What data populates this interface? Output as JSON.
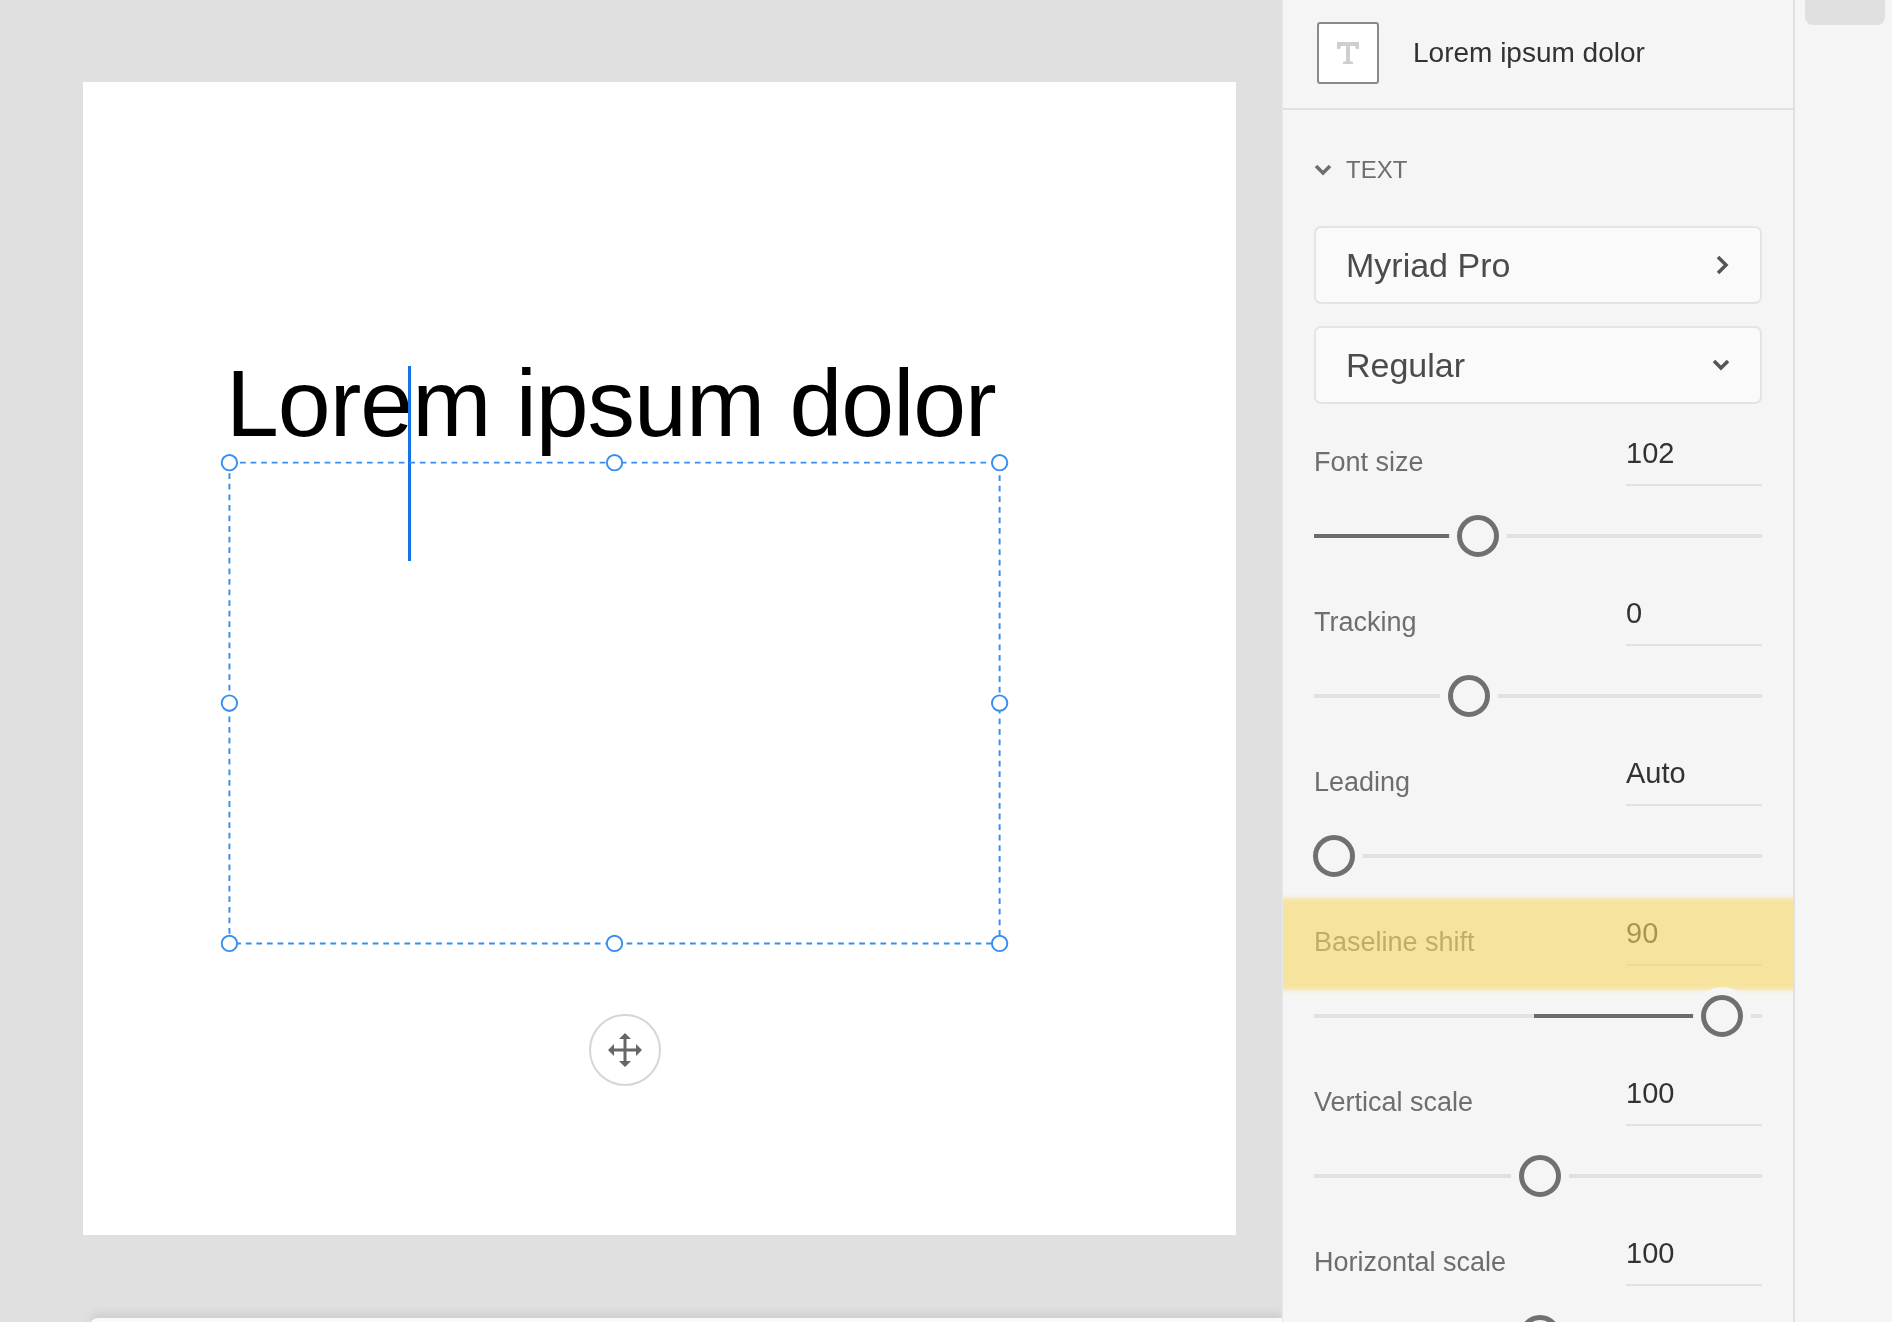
{
  "canvas": {
    "text": "Lorem ipsum dolor"
  },
  "panel": {
    "layer_name": "Lorem ipsum dolor",
    "section": {
      "title": "TEXT",
      "expanded": true
    },
    "font_family": "Myriad Pro",
    "font_style": "Regular",
    "sliders": [
      {
        "label": "Font size",
        "value": "102",
        "kind": "filled",
        "level": 0.365,
        "highlighted": false
      },
      {
        "label": "Tracking",
        "value": "0",
        "kind": "plain",
        "level": 0.347,
        "highlighted": false
      },
      {
        "label": "Leading",
        "value": "Auto",
        "kind": "plain",
        "level": 0.045,
        "highlighted": false
      },
      {
        "label": "Baseline shift",
        "value": "90",
        "kind": "centered",
        "level": 0.91,
        "highlighted": true
      },
      {
        "label": "Vertical scale",
        "value": "100",
        "kind": "plain",
        "level": 0.505,
        "highlighted": false
      },
      {
        "label": "Horizontal scale",
        "value": "100",
        "kind": "plain",
        "level": 0.505,
        "highlighted": false
      }
    ]
  }
}
